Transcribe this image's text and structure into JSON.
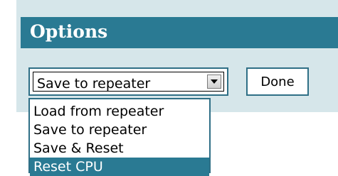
{
  "header": {
    "title": "Options"
  },
  "action_select": {
    "value": "Save to repeater",
    "options": [
      {
        "label": "Load from repeater",
        "highlighted": false
      },
      {
        "label": "Save to repeater",
        "highlighted": false
      },
      {
        "label": "Save & Reset",
        "highlighted": false
      },
      {
        "label": "Reset CPU",
        "highlighted": true
      }
    ]
  },
  "done_button": {
    "label": "Done"
  },
  "colors": {
    "accent": "#2a7a93",
    "panel": "#d6e6ea",
    "border": "#2f6f86"
  }
}
